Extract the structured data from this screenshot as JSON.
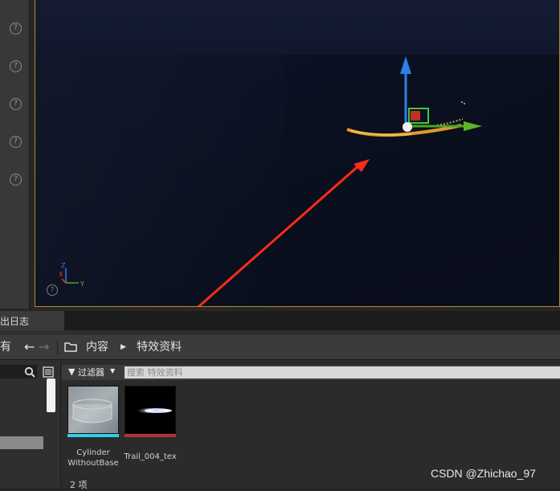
{
  "details_panel": {
    "help_icons": [
      "?",
      "?",
      "?",
      "?",
      "?"
    ]
  },
  "viewport": {
    "axis_labels": {
      "x": "X",
      "y": "Y",
      "z": "Z"
    },
    "help_icon": "?",
    "colors": {
      "x_axis": "#e23b2f",
      "y_axis": "#6fbf2a",
      "z_axis": "#2f7fe6",
      "annotation": "#ff2a1a",
      "frame": "#b8892a"
    }
  },
  "tabs": {
    "output_log": "出日志"
  },
  "toolbar": {
    "history_label": "有",
    "path": [
      "内容",
      "特效资料"
    ]
  },
  "assets": {
    "filter_label": "过滤器",
    "search_placeholder": "搜索 特效资料",
    "items": [
      {
        "label_line1": "Cylinder",
        "label_line2": "WithoutBase",
        "bar_color": "#2ad4e6"
      },
      {
        "label_line1": "Trail_004_tex",
        "label_line2": "",
        "bar_color": "#b03434"
      }
    ],
    "count_label": "2 项"
  },
  "watermark": "CSDN @Zhichao_97"
}
